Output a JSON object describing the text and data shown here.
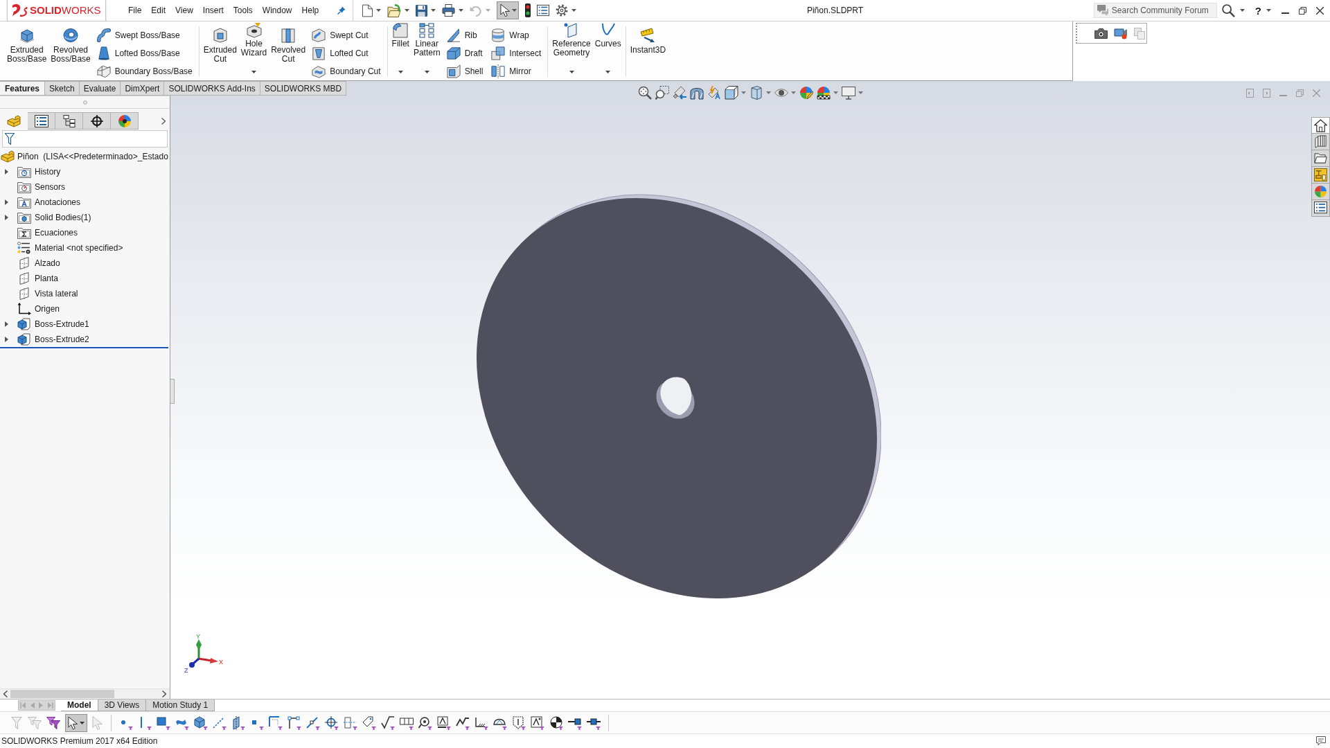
{
  "logo": {
    "wordmark": "**SOLID**WORKS"
  },
  "menu": [
    "File",
    "Edit",
    "View",
    "Insert",
    "Tools",
    "Window",
    "Help"
  ],
  "quick_access": {
    "undo_disabled": true,
    "select_pressed": true
  },
  "document": {
    "title": "Piñon.SLDPRT"
  },
  "search": {
    "placeholder": "Search Community Forum"
  },
  "help": {
    "label": "?"
  },
  "ribbon": {
    "groups": [
      {
        "items": [
          {
            "kind": "large",
            "label": "Extruded Boss/Base",
            "dropdown": false
          },
          {
            "kind": "large",
            "label": "Revolved Boss/Base",
            "dropdown": false
          },
          {
            "kind": "stack",
            "items": [
              {
                "label": "Swept Boss/Base"
              },
              {
                "label": "Lofted Boss/Base"
              },
              {
                "label": "Boundary Boss/Base"
              }
            ]
          }
        ]
      },
      {
        "items": [
          {
            "kind": "large",
            "label": "Extruded Cut",
            "dropdown": false
          },
          {
            "kind": "large",
            "label": "Hole Wizard",
            "dropdown": true
          },
          {
            "kind": "large",
            "label": "Revolved Cut",
            "dropdown": false
          },
          {
            "kind": "stack",
            "items": [
              {
                "label": "Swept Cut"
              },
              {
                "label": "Lofted Cut"
              },
              {
                "label": "Boundary Cut"
              }
            ]
          }
        ]
      },
      {
        "items": [
          {
            "kind": "large",
            "label": "Fillet",
            "dropdown": true
          },
          {
            "kind": "large",
            "label": "Linear Pattern",
            "dropdown": true
          },
          {
            "kind": "stack",
            "items": [
              {
                "label": "Rib"
              },
              {
                "label": "Draft"
              },
              {
                "label": "Shell"
              }
            ]
          },
          {
            "kind": "stack",
            "items": [
              {
                "label": "Wrap"
              },
              {
                "label": "Intersect"
              },
              {
                "label": "Mirror"
              }
            ]
          }
        ]
      },
      {
        "items": [
          {
            "kind": "large",
            "label": "Reference Geometry",
            "dropdown": true
          },
          {
            "kind": "large",
            "label": "Curves",
            "dropdown": true
          }
        ]
      },
      {
        "items": [
          {
            "kind": "large",
            "label": "Instant3D",
            "dropdown": false
          }
        ]
      }
    ]
  },
  "command_tabs": [
    {
      "label": "Features",
      "selected": true
    },
    {
      "label": "Sketch",
      "selected": false
    },
    {
      "label": "Evaluate",
      "selected": false
    },
    {
      "label": "DimXpert",
      "selected": false
    },
    {
      "label": "SOLIDWORKS Add-Ins",
      "selected": false
    },
    {
      "label": "SOLIDWORKS MBD",
      "selected": false
    }
  ],
  "feature_manager": {
    "tabs": [
      {
        "kind": "feature-tree",
        "selected": true
      },
      {
        "kind": "properties",
        "selected": false
      },
      {
        "kind": "configurations",
        "selected": false
      },
      {
        "kind": "dimxpert",
        "selected": false
      },
      {
        "kind": "display",
        "selected": false
      }
    ],
    "tree": {
      "label": "Piñon  (LISA<<Predeterminado>_Estado",
      "kind": "part",
      "children": [
        {
          "label": "History",
          "kind": "history",
          "expandable": true,
          "expanded": false
        },
        {
          "label": "Sensors",
          "kind": "sensors",
          "expandable": false,
          "expanded": false
        },
        {
          "label": "Anotaciones",
          "kind": "annotations",
          "expandable": true,
          "expanded": false
        },
        {
          "label": "Solid Bodies(1)",
          "kind": "bodies",
          "expandable": true,
          "expanded": false
        },
        {
          "label": "Ecuaciones",
          "kind": "equations",
          "expandable": false,
          "expanded": false
        },
        {
          "label": "Material <not specified>",
          "kind": "material",
          "expandable": false,
          "expanded": false
        },
        {
          "label": "Alzado",
          "kind": "plane",
          "expandable": false,
          "expanded": false
        },
        {
          "label": "Planta",
          "kind": "plane",
          "expandable": false,
          "expanded": false
        },
        {
          "label": "Vista lateral",
          "kind": "plane",
          "expandable": false,
          "expanded": false
        },
        {
          "label": "Origen",
          "kind": "origin",
          "expandable": false,
          "expanded": false
        },
        {
          "label": "Boss-Extrude1",
          "kind": "feature",
          "expandable": true,
          "expanded": false
        },
        {
          "label": "Boss-Extrude2",
          "kind": "feature",
          "expandable": true,
          "expanded": false
        }
      ]
    }
  },
  "viewport": {
    "triad": {
      "x_label": "X",
      "y_label": "Y",
      "z_label": "Z"
    }
  },
  "task_pane": {
    "tabs": [
      {
        "kind": "resources",
        "selected": true
      },
      {
        "kind": "library",
        "selected": false
      },
      {
        "kind": "explorer",
        "selected": false
      },
      {
        "kind": "palette",
        "selected": false
      },
      {
        "kind": "appearances",
        "selected": false
      },
      {
        "kind": "properties",
        "selected": false
      }
    ]
  },
  "model_tabs": [
    {
      "label": "Model",
      "selected": true
    },
    {
      "label": "3D Views",
      "selected": false
    },
    {
      "label": "Motion Study 1",
      "selected": false
    }
  ],
  "selection_filter": {
    "select_pressed": true
  },
  "status_bar": {
    "text": "SOLIDWORKS Premium 2017 x64 Edition"
  }
}
